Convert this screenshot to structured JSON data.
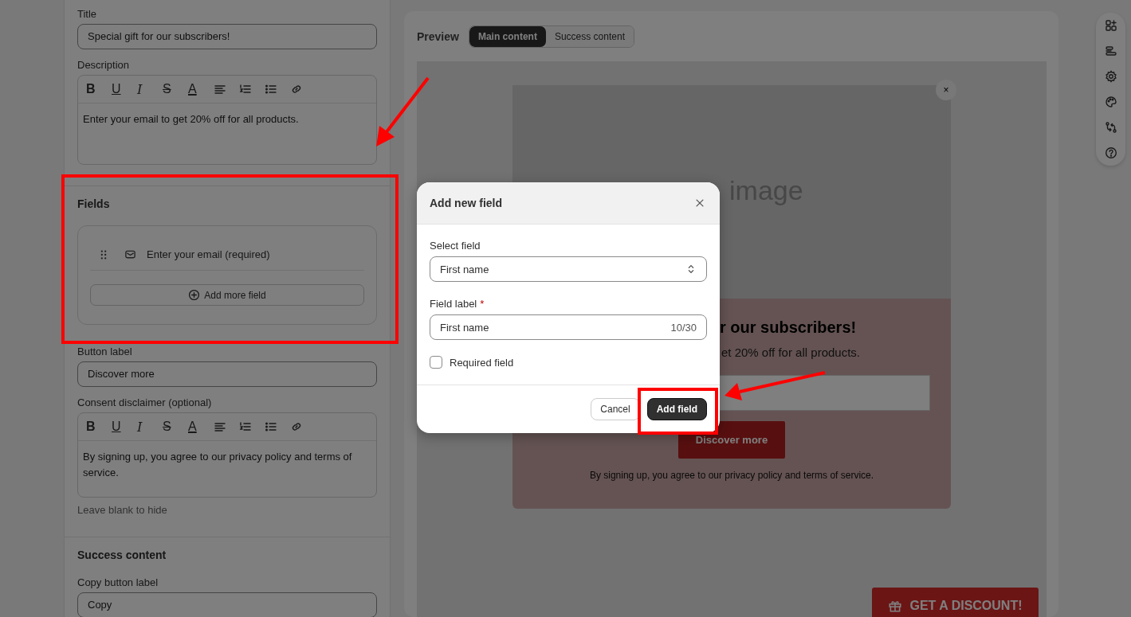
{
  "settings_panel": {
    "title_field": {
      "label": "Title",
      "value": "Special gift for our subscribers!"
    },
    "description_field": {
      "label": "Description",
      "value": "Enter your email to get 20% off for all products.",
      "toolbar": [
        {
          "kind": "bold",
          "glyph": "B"
        },
        {
          "kind": "underline",
          "glyph": "U"
        },
        {
          "kind": "italic",
          "glyph": "I"
        },
        {
          "kind": "strike",
          "glyph": "S"
        },
        {
          "kind": "color",
          "glyph": "A"
        },
        {
          "kind": "align"
        },
        {
          "kind": "ordered"
        },
        {
          "kind": "bullets"
        },
        {
          "kind": "link"
        }
      ]
    },
    "fields_section": {
      "heading": "Fields",
      "items": [
        {
          "kind": "email",
          "label": "Enter your email (required)"
        }
      ],
      "add_button": "Add more field"
    },
    "button_label_field": {
      "label": "Button label",
      "value": "Discover more"
    },
    "consent_field": {
      "label": "Consent disclaimer (optional)",
      "value": "By signing up, you agree to our privacy policy and terms of service.",
      "hint": "Leave blank to hide",
      "toolbar": [
        {
          "kind": "bold",
          "glyph": "B"
        },
        {
          "kind": "underline",
          "glyph": "U"
        },
        {
          "kind": "italic",
          "glyph": "I"
        },
        {
          "kind": "strike",
          "glyph": "S"
        },
        {
          "kind": "color",
          "glyph": "A"
        },
        {
          "kind": "align"
        },
        {
          "kind": "ordered"
        },
        {
          "kind": "bullets"
        },
        {
          "kind": "link"
        }
      ]
    },
    "success_section": {
      "heading": "Success content",
      "copy_button_field": {
        "label": "Copy button label",
        "value": "Copy"
      }
    }
  },
  "preview": {
    "label": "Preview",
    "tabs": [
      {
        "label": "Main content",
        "selected": true
      },
      {
        "label": "Success content",
        "selected": false
      }
    ],
    "popup": {
      "close": "×",
      "image_placeholder": "image",
      "title": "r our subscribers!",
      "description": "et 20% off for all products.",
      "button": "Discover more",
      "disclaimer": "By signing up, you agree to our privacy policy and terms of service."
    },
    "floating_button": "GET A DISCOUNT!"
  },
  "side_toolbar": [
    {
      "kind": "add-block"
    },
    {
      "kind": "layout"
    },
    {
      "kind": "settings"
    },
    {
      "kind": "palette"
    },
    {
      "kind": "swap"
    },
    {
      "kind": "help"
    }
  ],
  "dialog": {
    "title": "Add new field",
    "select": {
      "label": "Select field",
      "value": "First name"
    },
    "label_field": {
      "label": "Field label",
      "required": true,
      "required_mark": "*",
      "value": "First name",
      "counter": "10/30"
    },
    "required_checkbox": {
      "label": "Required field",
      "checked": false
    },
    "buttons": [
      {
        "label": "Cancel",
        "kind": "secondary"
      },
      {
        "label": "Add field",
        "kind": "primary"
      }
    ]
  }
}
